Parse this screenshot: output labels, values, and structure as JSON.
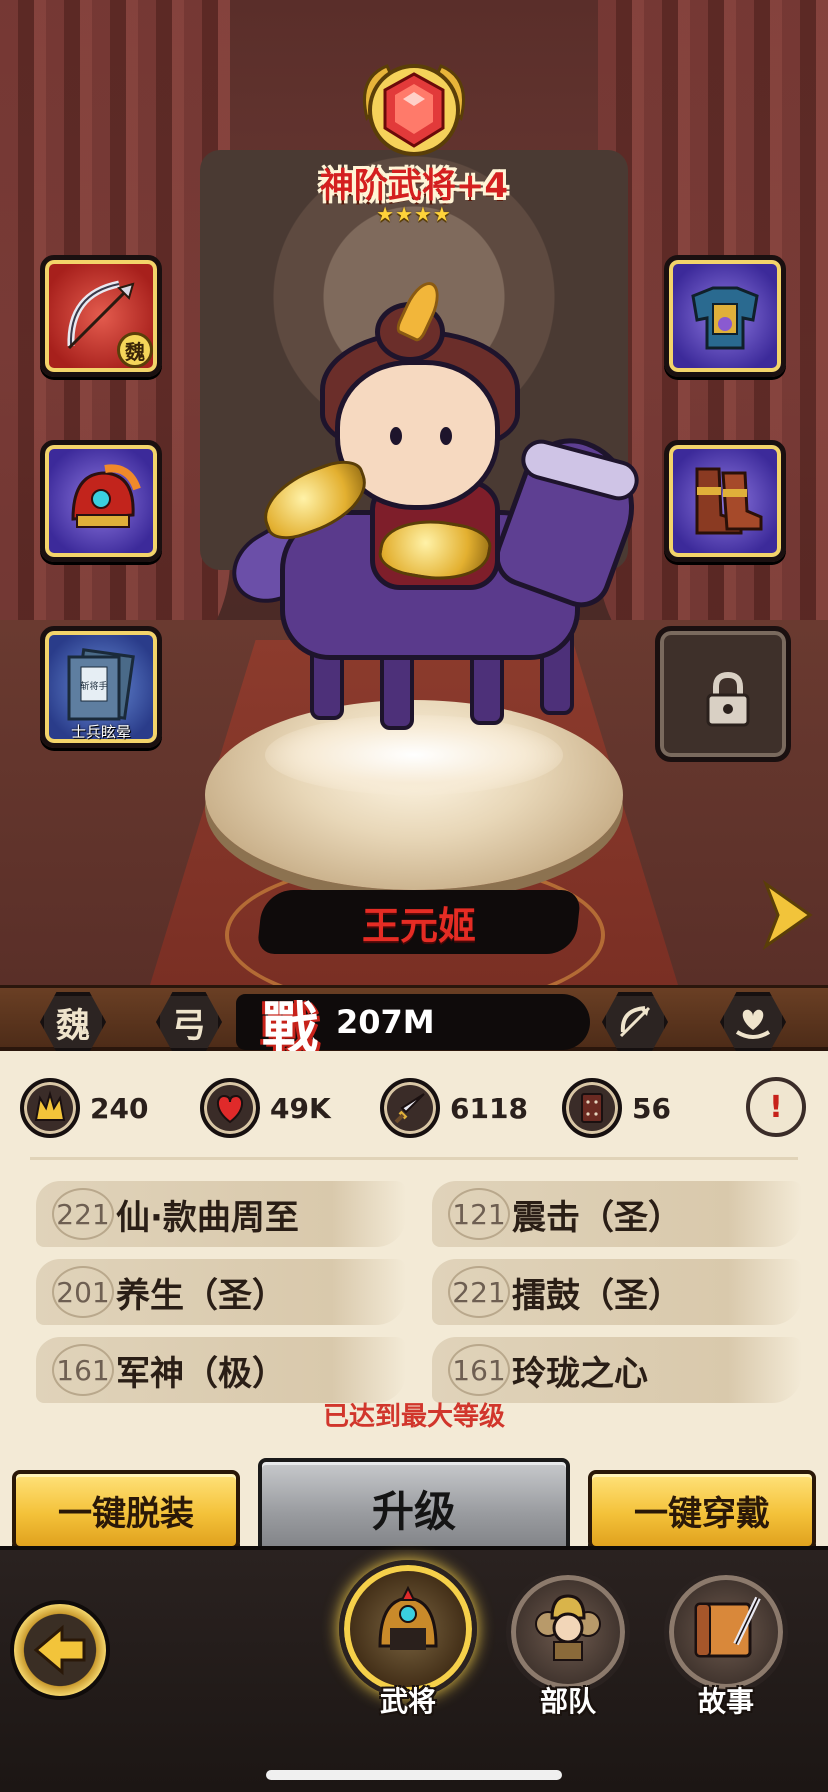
{
  "hero": {
    "rank_title": "神阶武将+4",
    "rank_stars": "★★★★",
    "name": "王元姬",
    "power_glyph": "戰",
    "power": "207M",
    "faction": "魏",
    "weapon_type": "弓",
    "equipment_badge": "魏",
    "book_title": "士兵眩晕",
    "book_cover_text": "斩将手"
  },
  "stats": {
    "leadership": "240",
    "hp": "49K",
    "attack": "6118",
    "defense": "56",
    "info_glyph": "!"
  },
  "skills": [
    {
      "level": "221",
      "name": "仙·款曲周至"
    },
    {
      "level": "121",
      "name": "震击（圣）"
    },
    {
      "level": "201",
      "name": "养生（圣）"
    },
    {
      "level": "221",
      "name": "擂鼓（圣）"
    },
    {
      "level": "161",
      "name": "军神（极）"
    },
    {
      "level": "161",
      "name": "玲珑之心"
    }
  ],
  "status": {
    "max_level": "已达到最大等级"
  },
  "actions": {
    "unequip_all": "一键脱装",
    "upgrade": "升级",
    "equip_all": "一键穿戴"
  },
  "nav": {
    "tabs": [
      {
        "label": "武将",
        "icon": "general-helmet-icon",
        "active": true
      },
      {
        "label": "部队",
        "icon": "troop-soldiers-icon",
        "active": false
      },
      {
        "label": "故事",
        "icon": "story-scroll-icon",
        "active": false
      }
    ]
  },
  "colors": {
    "rank_red": "#d41f1f",
    "name_red": "#e52c24",
    "gold": "#f4c23a",
    "panel_bg": "#f3ead6",
    "max_level_red": "#d1362c"
  }
}
